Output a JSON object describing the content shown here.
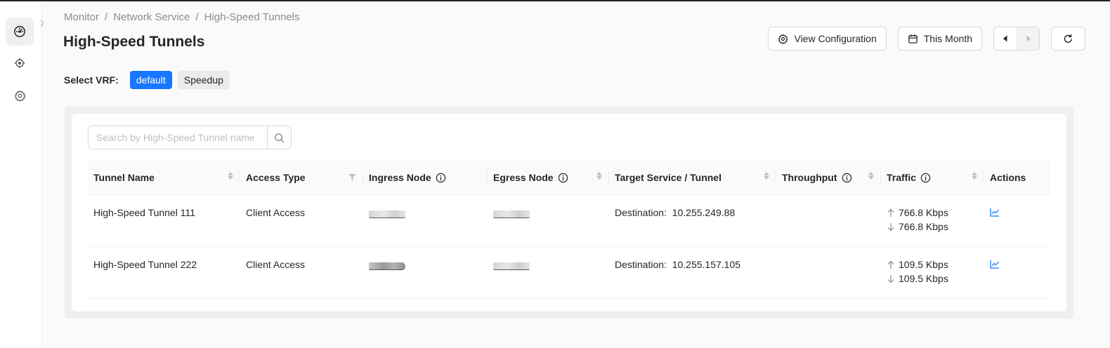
{
  "breadcrumb": {
    "items": [
      "Monitor",
      "Network Service",
      "High-Speed Tunnels"
    ],
    "separator": "/"
  },
  "page": {
    "title": "High-Speed Tunnels"
  },
  "toolbar": {
    "view_config_label": "View Configuration",
    "date_range_label": "This Month"
  },
  "sidebar": {
    "items": [
      {
        "icon": "dashboard-icon",
        "active": true
      },
      {
        "icon": "crosshair-icon",
        "active": false
      },
      {
        "icon": "gear-icon",
        "active": false
      }
    ]
  },
  "vrf": {
    "label": "Select VRF:",
    "options": [
      {
        "label": "default",
        "selected": true
      },
      {
        "label": "Speedup",
        "selected": false
      }
    ]
  },
  "search": {
    "placeholder": "Search by High-Speed Tunnel name",
    "value": ""
  },
  "table": {
    "columns": [
      "Tunnel Name",
      "Access Type",
      "Ingress Node",
      "Egress Node",
      "Target Service / Tunnel",
      "Throughput",
      "Traffic",
      "Actions"
    ],
    "rows": [
      {
        "name": "High-Speed Tunnel 111",
        "access": "Client Access",
        "target_label": "Destination:",
        "target_value": "10.255.249.88",
        "traffic_up": "766.8 Kbps",
        "traffic_down": "766.8 Kbps"
      },
      {
        "name": "High-Speed Tunnel 222",
        "access": "Client Access",
        "target_label": "Destination:",
        "target_value": "10.255.157.105",
        "traffic_up": "109.5 Kbps",
        "traffic_down": "109.5 Kbps"
      }
    ]
  },
  "colors": {
    "accent": "#1677ff",
    "border": "#d9d9d9",
    "muted": "#8c8c8c"
  }
}
